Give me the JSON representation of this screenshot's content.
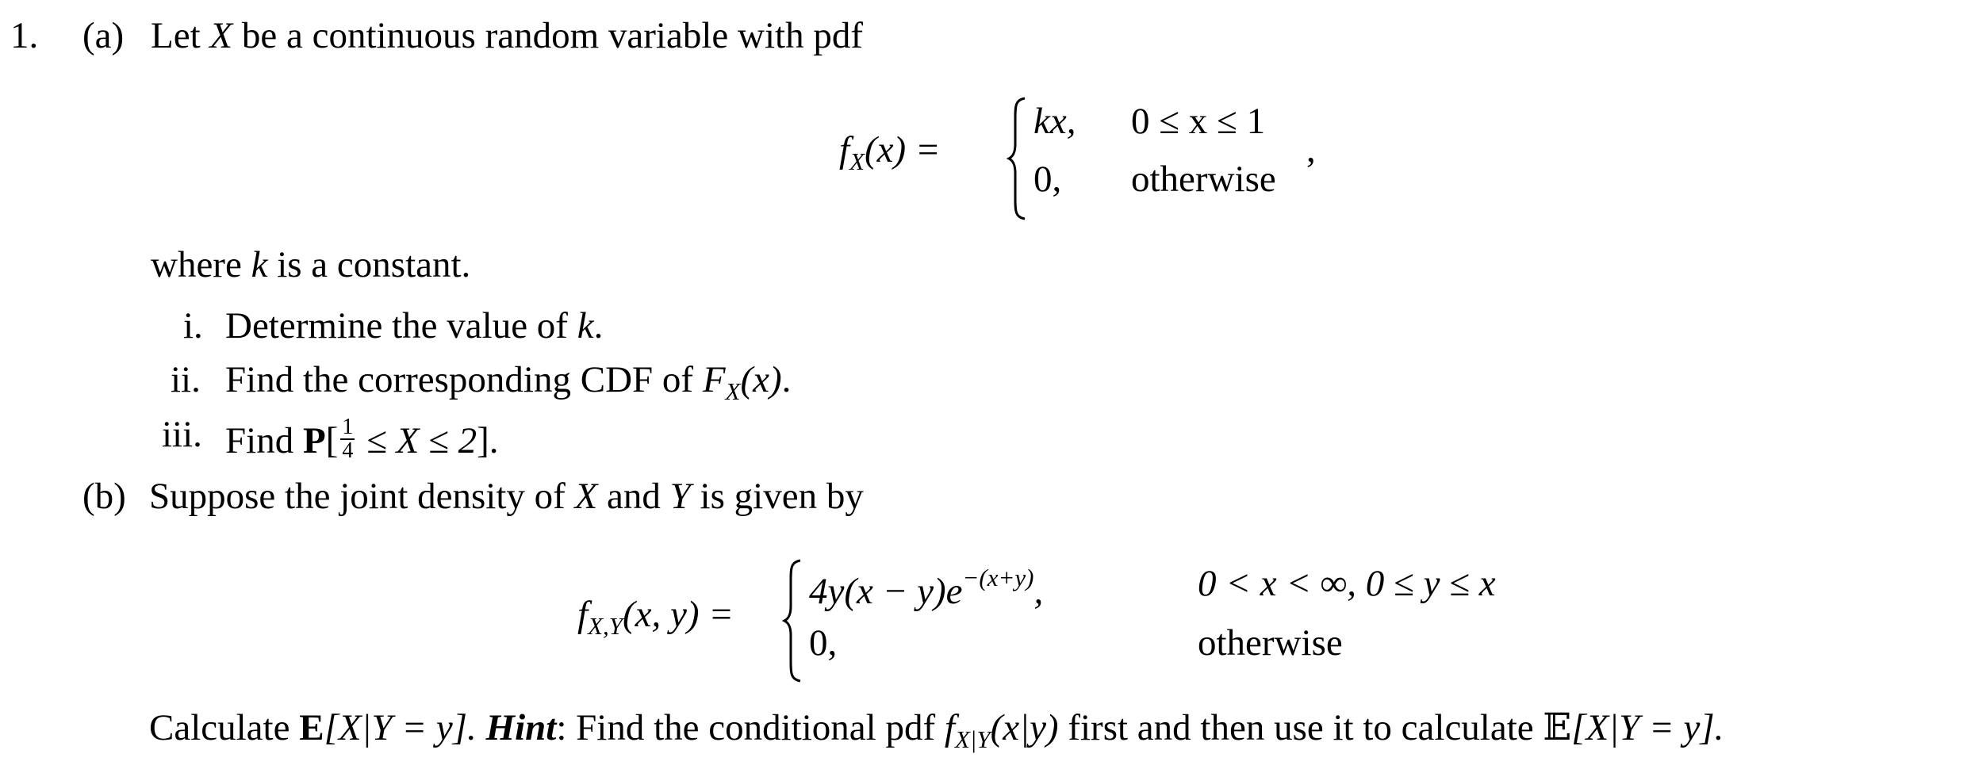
{
  "problem": {
    "number": "1.",
    "part_a": {
      "label": "(a)",
      "intro": "Let",
      "var_X": "X",
      "intro_rest": "be a continuous random variable with pdf",
      "pdf_lhs": "f",
      "pdf_lhs_sub": "X",
      "pdf_lhs_arg": "(x) =",
      "case1_expr": "kx,",
      "case1_cond": "0 ≤ x ≤ 1",
      "case2_expr": "0,",
      "case2_cond": "otherwise",
      "trailing_comma": ",",
      "where_pre": "where",
      "where_k": "k",
      "where_post": "is a constant.",
      "items": [
        {
          "num": "i.",
          "text_pre": "Determine the value of",
          "math": "k",
          "text_post": "."
        },
        {
          "num": "ii.",
          "text_pre": "Find the corresponding CDF of",
          "math": "F",
          "math_sub": "X",
          "math_arg": "(x)",
          "text_post": "."
        },
        {
          "num": "iii.",
          "text_pre": "Find",
          "bold": "P",
          "open": "[",
          "frac_num": "1",
          "frac_den": "4",
          "math": "≤ X ≤ 2",
          "close": "].",
          "text_post": ""
        }
      ]
    },
    "part_b": {
      "label": "(b)",
      "intro": "Suppose the joint density of",
      "var_X": "X",
      "and": "and",
      "var_Y": "Y",
      "intro_rest": "is given by",
      "pdf_lhs": "f",
      "pdf_lhs_sub": "X,Y",
      "pdf_lhs_arg": "(x, y) =",
      "case1_expr": "4y(x − y)e",
      "case1_exp": "−(x+y)",
      "case1_comma": ",",
      "case1_cond": "0 < x < ∞, 0 ≤ y ≤ x",
      "case2_expr": "0,",
      "case2_cond": "otherwise",
      "task_pre": "Calculate",
      "task_E": "E",
      "task_expr": "[X|Y = y].",
      "hint_label": "Hint",
      "hint_text": ": Find the conditional pdf",
      "hint_f": "f",
      "hint_f_sub": "X|Y",
      "hint_f_arg": "(x|y)",
      "hint_rest": "first and then use it to calculate",
      "hint_E": "𝔼",
      "hint_expr": "[X|Y = y]."
    }
  }
}
